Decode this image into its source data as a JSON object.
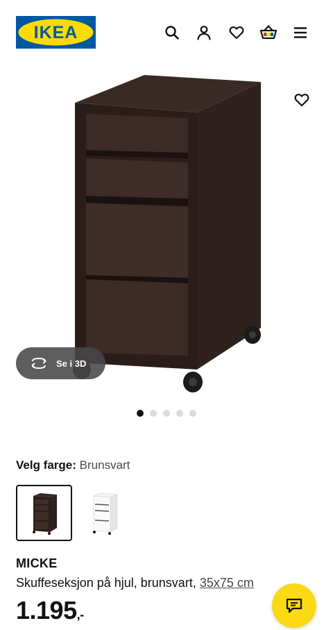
{
  "brand": {
    "logo_text": "IKEA",
    "logo_blue": "#0058a3",
    "logo_yellow": "#ffdb00"
  },
  "header": {
    "icons": [
      "search-icon",
      "user-icon",
      "heart-icon",
      "cart-icon",
      "menu-icon"
    ]
  },
  "hero": {
    "view_3d_label": "Se i 3D",
    "carousel_total": 5,
    "carousel_active": 1
  },
  "color_select": {
    "label": "Velg farge:",
    "value": "Brunsvart",
    "options": [
      "Brunsvart",
      "Hvit"
    ]
  },
  "product": {
    "name": "MICKE",
    "description": "Skuffeseksjon på hjul, brunsvart, ",
    "dimensions": "35x75 cm",
    "price": "1.195",
    "price_suffix": ",-"
  },
  "colors": {
    "accent_yellow": "#fbd914",
    "text": "#111111",
    "muted": "#484848"
  }
}
